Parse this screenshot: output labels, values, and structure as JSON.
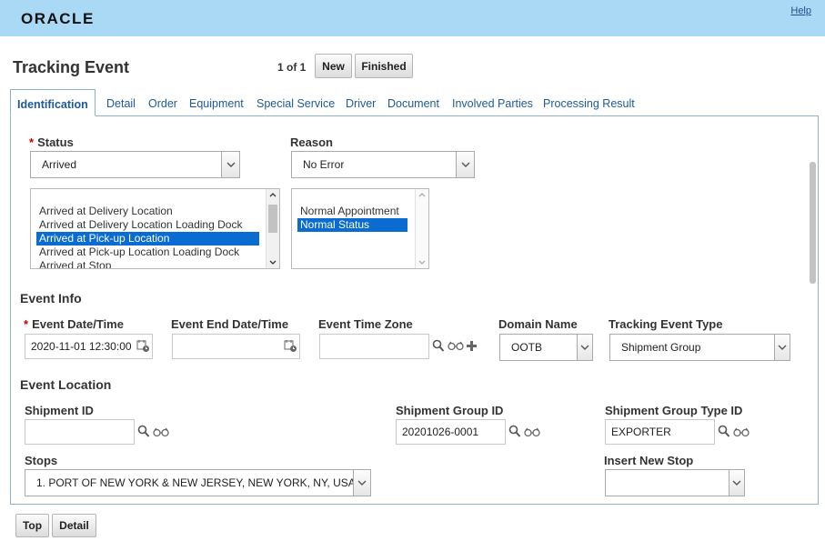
{
  "header": {
    "logo": "ORACLE",
    "help": "Help"
  },
  "page": {
    "title": "Tracking Event",
    "pager": "1 of 1",
    "new_button": "New",
    "finished_button": "Finished"
  },
  "tabs": [
    "Identification",
    "Detail",
    "Order",
    "Equipment",
    "Special Service",
    "Driver",
    "Document",
    "Involved Parties",
    "Processing Result"
  ],
  "status": {
    "label": "Status",
    "value": "Arrived",
    "options": [
      "Arrived at Delivery Location",
      "Arrived at Delivery Location Loading Dock",
      "Arrived at Pick-up Location",
      "Arrived at Pick-up Location Loading Dock",
      "Arrived at Stop"
    ],
    "selected": "Arrived at Pick-up Location"
  },
  "reason": {
    "label": "Reason",
    "value": "No Error",
    "options": [
      "Normal Appointment",
      "Normal Status"
    ],
    "selected": "Normal Status"
  },
  "event_info": {
    "title": "Event Info",
    "event_datetime_label": "Event Date/Time",
    "event_datetime": "2020-11-01 12:30:00",
    "event_end_label": "Event End Date/Time",
    "event_end": "",
    "time_zone_label": "Event Time Zone",
    "time_zone": "",
    "domain_label": "Domain Name",
    "domain": "OOTB",
    "type_label": "Tracking Event Type",
    "type": "Shipment Group"
  },
  "event_location": {
    "title": "Event Location",
    "shipment_id_label": "Shipment ID",
    "shipment_id": "",
    "shipment_group_id_label": "Shipment Group ID",
    "shipment_group_id": "20201026-0001",
    "shipment_group_type_label": "Shipment Group Type ID",
    "shipment_group_type": "EXPORTER",
    "stops_label": "Stops",
    "stops": "1. PORT OF NEW YORK & NEW JERSEY, NEW YORK, NY, USA",
    "insert_stop_label": "Insert New Stop",
    "insert_stop": ""
  },
  "footer": {
    "top_button": "Top",
    "detail_button": "Detail"
  }
}
